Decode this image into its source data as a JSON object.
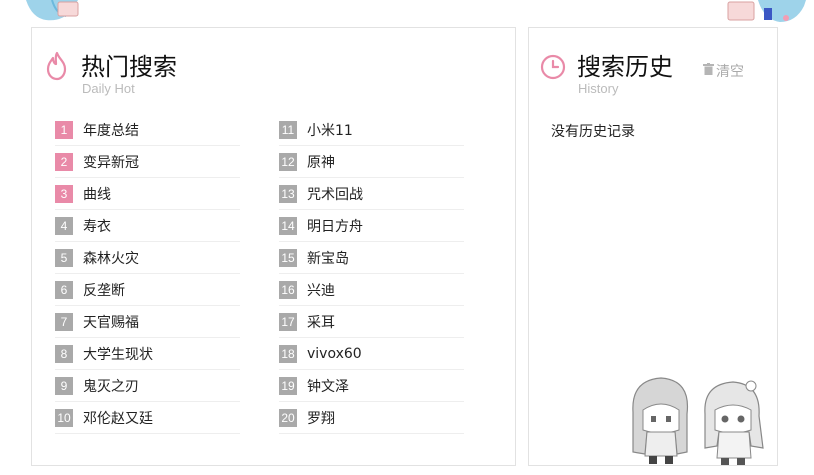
{
  "hot": {
    "title": "热门搜索",
    "subtitle": "Daily Hot",
    "items": [
      {
        "rank": "1",
        "keyword": "年度总结"
      },
      {
        "rank": "2",
        "keyword": "变异新冠"
      },
      {
        "rank": "3",
        "keyword": "曲线"
      },
      {
        "rank": "4",
        "keyword": "寿衣"
      },
      {
        "rank": "5",
        "keyword": "森林火灾"
      },
      {
        "rank": "6",
        "keyword": "反垄断"
      },
      {
        "rank": "7",
        "keyword": "天官赐福"
      },
      {
        "rank": "8",
        "keyword": "大学生现状"
      },
      {
        "rank": "9",
        "keyword": "鬼灭之刃"
      },
      {
        "rank": "10",
        "keyword": "邓伦赵又廷"
      },
      {
        "rank": "11",
        "keyword": "小米11"
      },
      {
        "rank": "12",
        "keyword": "原神"
      },
      {
        "rank": "13",
        "keyword": "咒术回战"
      },
      {
        "rank": "14",
        "keyword": "明日方舟"
      },
      {
        "rank": "15",
        "keyword": "新宝岛"
      },
      {
        "rank": "16",
        "keyword": "兴迪"
      },
      {
        "rank": "17",
        "keyword": "采耳"
      },
      {
        "rank": "18",
        "keyword": "vivox60"
      },
      {
        "rank": "19",
        "keyword": "钟文泽"
      },
      {
        "rank": "20",
        "keyword": "罗翔"
      }
    ]
  },
  "history": {
    "title": "搜索历史",
    "subtitle": "History",
    "clear_label": "清空",
    "empty_text": "没有历史记录"
  },
  "colors": {
    "accent_pink": "#e98aa8",
    "rank_gray": "#a9a9a9"
  },
  "icons": {
    "hot": "flame-icon",
    "history": "clock-icon",
    "clear": "trash-icon"
  }
}
